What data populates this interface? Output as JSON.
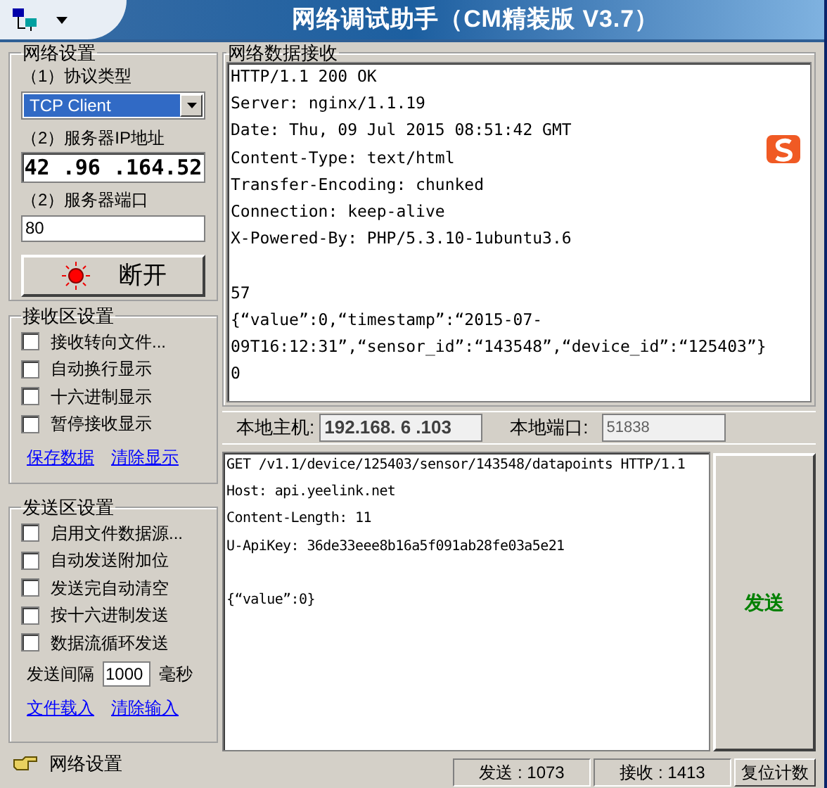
{
  "window": {
    "title": "网络调试助手（CM精装版 V3.7）"
  },
  "network_settings": {
    "legend": "网络设置",
    "protocol_label": "（1）协议类型",
    "protocol_value": "TCP Client",
    "ip_label": "（2）服务器IP地址",
    "ip_value": "42 .96 .164.52",
    "port_label": "（2）服务器端口",
    "port_value": "80",
    "connect_button": "断开",
    "connected": true
  },
  "receive_settings": {
    "legend": "接收区设置",
    "options": [
      {
        "label": "接收转向文件...",
        "checked": false
      },
      {
        "label": "自动换行显示",
        "checked": false
      },
      {
        "label": "十六进制显示",
        "checked": false
      },
      {
        "label": "暂停接收显示",
        "checked": false
      }
    ],
    "links": [
      "保存数据",
      "清除显示"
    ]
  },
  "send_settings": {
    "legend": "发送区设置",
    "options": [
      {
        "label": "启用文件数据源...",
        "checked": false
      },
      {
        "label": "自动发送附加位",
        "checked": false
      },
      {
        "label": "发送完自动清空",
        "checked": false
      },
      {
        "label": "按十六进制发送",
        "checked": false
      },
      {
        "label": "数据流循环发送",
        "checked": false
      }
    ],
    "interval_label": "发送间隔",
    "interval_value": "1000",
    "interval_unit": "毫秒",
    "links": [
      "文件载入",
      "清除输入"
    ]
  },
  "receive_panel": {
    "legend": "网络数据接收",
    "blocks": [
      {
        "lines": [
          "HTTP/1.1 200 OK",
          "Server: nginx/1.1.19",
          "Date: Thu, 09 Jul 2015 08:51:42 GMT",
          "Content-Type: text/html",
          "Transfer-Encoding: chunked",
          "Connection: keep-alive",
          "X-Powered-By: PHP/5.3.10-1ubuntu3.6"
        ]
      },
      {
        "lines": [
          "57",
          "{“value”:0,“timestamp”:“2015-07-",
          "09T16:12:31”,“sensor_id”:“143548”,“device_id”:“125403”}",
          "0"
        ]
      }
    ]
  },
  "local": {
    "host_label": "本地主机:",
    "host_value": "192.168. 6 .103",
    "port_label": "本地端口:",
    "port_value": "51838"
  },
  "send_panel": {
    "blocks": [
      {
        "lines": [
          "GET /v1.1/device/125403/sensor/143548/datapoints HTTP/1.1",
          "Host: api.yeelink.net",
          "Content-Length: 11",
          "U-ApiKey: 36de33eee8b16a5f091ab28fe03a5e21"
        ]
      },
      {
        "lines": [
          "{“value”:0}"
        ]
      }
    ],
    "send_button": "发送"
  },
  "status_bar": {
    "text": "网络设置",
    "sent": "发送 : 1073",
    "received": "接收 : 1413",
    "reset_button": "复位计数"
  }
}
